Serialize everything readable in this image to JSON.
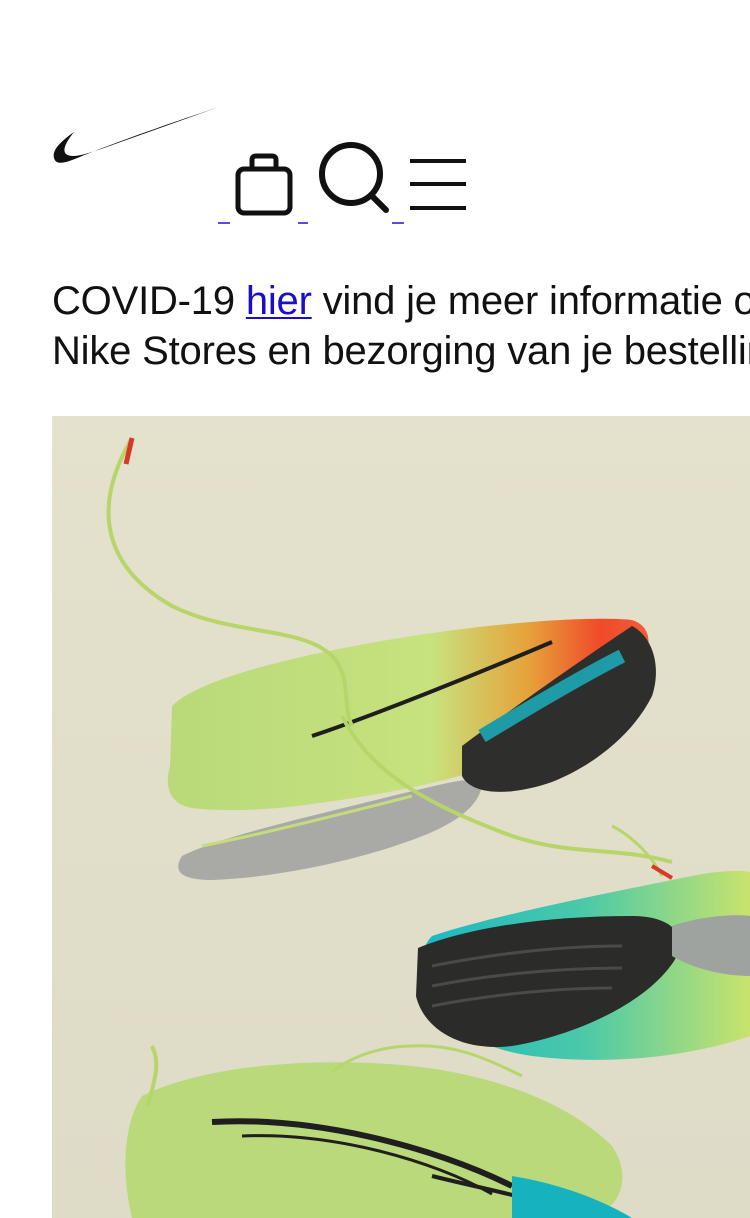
{
  "header": {
    "logo_icon": "nike-swoosh-icon",
    "bag_icon": "shopping-bag-icon",
    "search_icon": "search-icon",
    "menu_icon": "hamburger-menu-icon"
  },
  "notice": {
    "prefix": "COVID-19 ",
    "link_text": "hier",
    "line1_rest": " vind je meer informatie over",
    "line2": "Nike Stores en bezorging van je bestelling."
  },
  "hero": {
    "image_subject": "running-shoes-photo",
    "background_color": "#e5e2cf"
  },
  "colors": {
    "link": "#1a0dcc",
    "text": "#111111"
  }
}
